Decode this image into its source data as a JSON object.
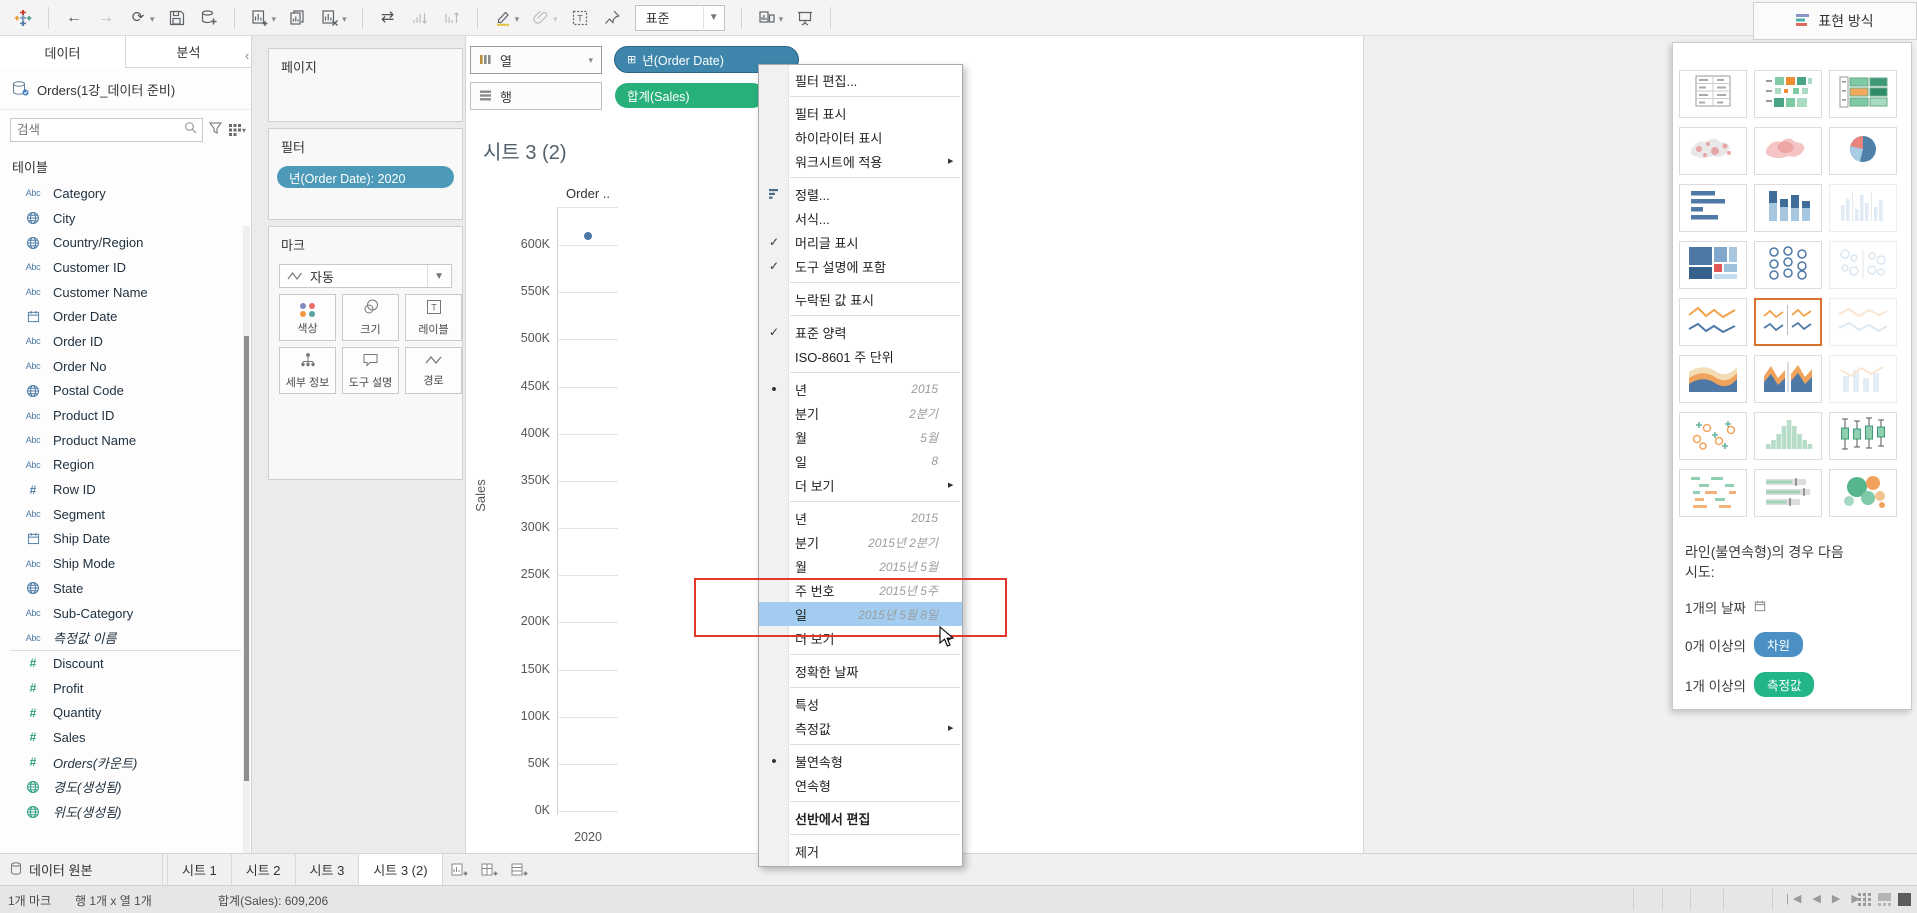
{
  "toolbar": {
    "fit_label": "표준",
    "icons": [
      {
        "glyph": "tableau-logo"
      },
      {
        "sep": true
      },
      {
        "glyph": "undo-arrow"
      },
      {
        "glyph": "redo-arrow",
        "disabled": true
      },
      {
        "glyph": "replay",
        "caret": true
      },
      {
        "glyph": "save"
      },
      {
        "glyph": "add-data"
      },
      {
        "sep": true
      },
      {
        "glyph": "new-worksheet",
        "caret": true
      },
      {
        "glyph": "duplicate-sheet"
      },
      {
        "glyph": "clear-sheet",
        "caret": true
      },
      {
        "sep": true
      },
      {
        "glyph": "swap-axes"
      },
      {
        "glyph": "sort-ascending",
        "disabled": true
      },
      {
        "glyph": "sort-descending",
        "disabled": true
      },
      {
        "sep": true
      },
      {
        "glyph": "highlight-pen",
        "caret": true
      },
      {
        "glyph": "paperclip",
        "caret": true,
        "disabled": true
      },
      {
        "glyph": "text-label"
      },
      {
        "glyph": "pin"
      }
    ],
    "icons_right": [
      {
        "sep": true
      },
      {
        "glyph": "fit-device",
        "caret": true
      },
      {
        "glyph": "presentation"
      },
      {
        "sep": true
      }
    ]
  },
  "sidebar": {
    "tabs": [
      {
        "label": "데이터",
        "active": true
      },
      {
        "label": "분석"
      }
    ],
    "datasource": "Orders(1강_데이터 준비)",
    "search_placeholder": "검색",
    "tables_header": "테이블",
    "fields": [
      {
        "name": "Category",
        "icon": "abc",
        "kind": "dim"
      },
      {
        "name": "City",
        "icon": "globe",
        "kind": "dim"
      },
      {
        "name": "Country/Region",
        "icon": "globe",
        "kind": "dim"
      },
      {
        "name": "Customer ID",
        "icon": "abc",
        "kind": "dim"
      },
      {
        "name": "Customer Name",
        "icon": "abc",
        "kind": "dim"
      },
      {
        "name": "Order Date",
        "icon": "calendar",
        "kind": "dim"
      },
      {
        "name": "Order ID",
        "icon": "abc",
        "kind": "dim"
      },
      {
        "name": "Order No",
        "icon": "abc",
        "kind": "dim"
      },
      {
        "name": "Postal Code",
        "icon": "globe",
        "kind": "dim"
      },
      {
        "name": "Product ID",
        "icon": "abc",
        "kind": "dim"
      },
      {
        "name": "Product Name",
        "icon": "abc",
        "kind": "dim"
      },
      {
        "name": "Region",
        "icon": "abc",
        "kind": "dim"
      },
      {
        "name": "Row ID",
        "icon": "hash",
        "kind": "dim"
      },
      {
        "name": "Segment",
        "icon": "abc",
        "kind": "dim"
      },
      {
        "name": "Ship Date",
        "icon": "calendar",
        "kind": "dim"
      },
      {
        "name": "Ship Mode",
        "icon": "abc",
        "kind": "dim"
      },
      {
        "name": "State",
        "icon": "globe",
        "kind": "dim"
      },
      {
        "name": "Sub-Category",
        "icon": "abc",
        "kind": "dim"
      },
      {
        "name": "측정값 이름",
        "icon": "abc",
        "kind": "dim",
        "italic": true
      },
      {
        "divider": true
      },
      {
        "name": "Discount",
        "icon": "hash",
        "kind": "measure"
      },
      {
        "name": "Profit",
        "icon": "hash",
        "kind": "measure"
      },
      {
        "name": "Quantity",
        "icon": "hash",
        "kind": "measure"
      },
      {
        "name": "Sales",
        "icon": "hash",
        "kind": "measure"
      },
      {
        "name": "Orders(카운트)",
        "icon": "hash",
        "kind": "measure",
        "italic": true
      },
      {
        "name": "경도(생성됨)",
        "icon": "globe",
        "kind": "measure",
        "italic": true
      },
      {
        "name": "위도(생성됨)",
        "icon": "globe",
        "kind": "measure",
        "italic": true
      }
    ]
  },
  "shelves": {
    "pages_label": "페이지",
    "filters_label": "필터",
    "filter_pill": "년(Order Date): 2020",
    "marks_label": "마크",
    "mark_type": "자동",
    "mark_buttons": [
      {
        "label": "색상",
        "glyph": "color-icon"
      },
      {
        "label": "크기",
        "glyph": "size-icon"
      },
      {
        "label": "레이블",
        "glyph": "label-icon"
      },
      {
        "label": "세부 정보",
        "glyph": "detail-icon"
      },
      {
        "label": "도구 설명",
        "glyph": "tooltip-icon"
      },
      {
        "label": "경로",
        "glyph": "path-icon"
      }
    ]
  },
  "columns_shelf": {
    "label": "열",
    "pill": "년(Order Date)"
  },
  "rows_shelf": {
    "label": "행",
    "pill": "합계(Sales)"
  },
  "sheet": {
    "title": "시트 3 (2)"
  },
  "chart_data": {
    "type": "line",
    "title": "시트 3 (2)",
    "col_header": "Order ..",
    "x": [
      "2020"
    ],
    "xlabel": "",
    "ylabel": "Sales",
    "yticks": [
      "600K",
      "550K",
      "500K",
      "450K",
      "400K",
      "350K",
      "300K",
      "250K",
      "200K",
      "150K",
      "100K",
      "50K",
      "0K"
    ],
    "ylim": [
      0,
      640000
    ],
    "grid": true,
    "series": [
      {
        "name": "합계(Sales)",
        "values": [
          609206
        ]
      }
    ]
  },
  "context_menu": {
    "items": [
      {
        "label": "필터 편집..."
      },
      {
        "divider": true
      },
      {
        "label": "필터 표시"
      },
      {
        "label": "하이라이터 표시"
      },
      {
        "label": "워크시트에 적용",
        "arrow": true
      },
      {
        "divider": true
      },
      {
        "label": "정렬...",
        "icon": "sort"
      },
      {
        "label": "서식..."
      },
      {
        "label": "머리글 표시",
        "mark": "check"
      },
      {
        "label": "도구 설명에 포함",
        "mark": "check"
      },
      {
        "divider": true
      },
      {
        "label": "누락된 값 표시"
      },
      {
        "divider": true
      },
      {
        "label": "표준 양력",
        "mark": "check"
      },
      {
        "label": "ISO-8601 주 단위"
      },
      {
        "divider": true
      },
      {
        "label": "년",
        "hint": "2015",
        "mark": "bullet"
      },
      {
        "label": "분기",
        "hint": "2분기"
      },
      {
        "label": "월",
        "hint": "5월"
      },
      {
        "label": "일",
        "hint": "8"
      },
      {
        "label": "더 보기",
        "arrow": true
      },
      {
        "divider": true
      },
      {
        "label": "년",
        "hint": "2015"
      },
      {
        "label": "분기",
        "hint": "2015년 2분기"
      },
      {
        "label": "월",
        "hint": "2015년 5월"
      },
      {
        "label": "주 번호",
        "hint": "2015년 5주"
      },
      {
        "label": "일",
        "hint": "2015년 5월 8일",
        "highlighted": true
      },
      {
        "label": "더 보기",
        "arrow": true
      },
      {
        "divider": true
      },
      {
        "label": "정확한 날짜"
      },
      {
        "divider": true
      },
      {
        "label": "특성"
      },
      {
        "label": "측정값",
        "arrow": true
      },
      {
        "divider": true
      },
      {
        "label": "불연속형",
        "mark": "bullet"
      },
      {
        "label": "연속형"
      },
      {
        "divider": true
      },
      {
        "label": "선반에서 편집",
        "bold": true
      },
      {
        "divider": true
      },
      {
        "label": "제거"
      }
    ]
  },
  "annotation": {
    "color": "#e2382c"
  },
  "showme": {
    "header": "표현 방식",
    "thumbs": [
      {
        "type": "text-table"
      },
      {
        "type": "highlight-table"
      },
      {
        "type": "heat-map"
      },
      {
        "type": "symbol-map"
      },
      {
        "type": "filled-map"
      },
      {
        "type": "pie"
      },
      {
        "type": "h-bars"
      },
      {
        "type": "stacked-bars"
      },
      {
        "type": "side-bars",
        "disabled": true
      },
      {
        "type": "treemap"
      },
      {
        "type": "circle-views"
      },
      {
        "type": "side-circles",
        "disabled": true
      },
      {
        "type": "lines-cont"
      },
      {
        "type": "lines-disc",
        "selected": true
      },
      {
        "type": "dual-lines",
        "disabled": true
      },
      {
        "type": "area-cont"
      },
      {
        "type": "area-disc"
      },
      {
        "type": "dual-combo",
        "disabled": true
      },
      {
        "type": "scatter"
      },
      {
        "type": "histogram"
      },
      {
        "type": "boxplot"
      },
      {
        "type": "gantt"
      },
      {
        "type": "bullet"
      },
      {
        "type": "bubbles"
      }
    ],
    "footer_try_1": "라인(불연속형)의 경우 다음",
    "footer_try_2": "시도:",
    "req_date": "1개의 날짜",
    "req_dim_prefix": "0개 이상의",
    "req_dim_pill": "차원",
    "req_measure_prefix": "1개 이상의",
    "req_measure_pill": "측정값"
  },
  "tabs": {
    "datasource": "데이터 원본",
    "sheets": [
      {
        "label": "시트 1"
      },
      {
        "label": "시트 2"
      },
      {
        "label": "시트 3"
      },
      {
        "label": "시트 3 (2)",
        "active": true
      }
    ]
  },
  "statusbar": {
    "marks": "1개 마크",
    "size": "행 1개 x 열 1개",
    "agg": "합계(Sales): 609,206"
  }
}
